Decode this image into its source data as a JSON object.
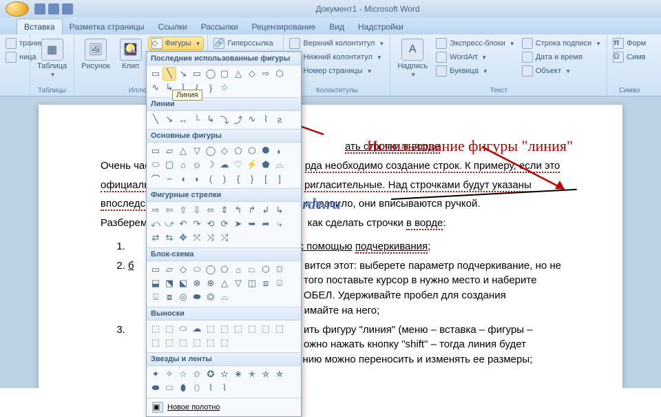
{
  "window": {
    "title": "Документ1 - Microsoft Word"
  },
  "tabs": {
    "home": "",
    "insert": "Вставка",
    "layout": "Разметка страницы",
    "refs": "Ссылки",
    "mail": "Рассылки",
    "review": "Рецензирование",
    "view": "Вид",
    "addins": "Надстройки"
  },
  "groups": {
    "pages": {
      "label": "траница",
      "sub": "ница",
      "grp": ""
    },
    "tables": {
      "btn": "Таблица",
      "grp": "Таблицы"
    },
    "illus": {
      "pic": "Рисунок",
      "clip": "Клип",
      "shapes": "Фигуры",
      "grp": "Иллюст"
    },
    "links": {
      "hyper": "Гиперссылка",
      "grp": ""
    },
    "headfoot": {
      "header": "Верхний колонтитул",
      "footer": "Нижний колонтитул",
      "pageno": "Номер страницы",
      "grp": "Колонтитулы"
    },
    "text": {
      "textbox": "Надпись",
      "quick": "Экспресс-блоки",
      "wordart": "WordArt",
      "dropcap": "Буквица",
      "sig": "Строка подписи",
      "date": "Дата и время",
      "obj": "Объект",
      "grp": "Текст"
    },
    "symbols": {
      "eq": "Форм",
      "sym": "Симв",
      "grp": "Симво"
    }
  },
  "shapes": {
    "recent_hdr": "Последние использованные фигуры",
    "lines_hdr": "Линии",
    "basic_hdr": "Основные фигуры",
    "arrows_hdr": "Фигурные стрелки",
    "flow_hdr": "Блок-схема",
    "callouts_hdr": "Выноски",
    "stars_hdr": "Звезды и ленты",
    "new_canvas": "Новое полотно",
    "tooltip": "Линия"
  },
  "doc": {
    "title_line": "ать строчки в ворде",
    "p1a": "Очень час",
    "p1b": "рда необходимо создание строк. К примеру, если это",
    "p2a": "официаль",
    "p2b": "ригласительные. Над строчками будут указаны",
    "p3a": "впоследс",
    "p3b": "к правило, они вписываются ручкой.",
    "p4a": "Разберем",
    "p4b": "как сделать строчки",
    "p4c": "в ворде",
    "li1a": "с помощью",
    "li1b": "подчеркивания",
    "li2a": "б",
    "li2b": "вится этот: выберете параметр подчеркивание, но не",
    "li2c": "того поставьте курсор в нужно место и наберите",
    "li2d": "ОБЕЛ. Удерживайте пробел для создания",
    "p5": "имайте на него;",
    "li3a": "ить фигуру \"линия\" (меню – вставка – фигуры –",
    "li3b": "ожно нажать кнопку \"shift\" – тогда линия будет",
    "li3c": "нию можно переносить и изменять ее размеры;"
  },
  "annotation": "Использование фигуры \"линия\"",
  "watermark": "kak-v-worde.ru"
}
